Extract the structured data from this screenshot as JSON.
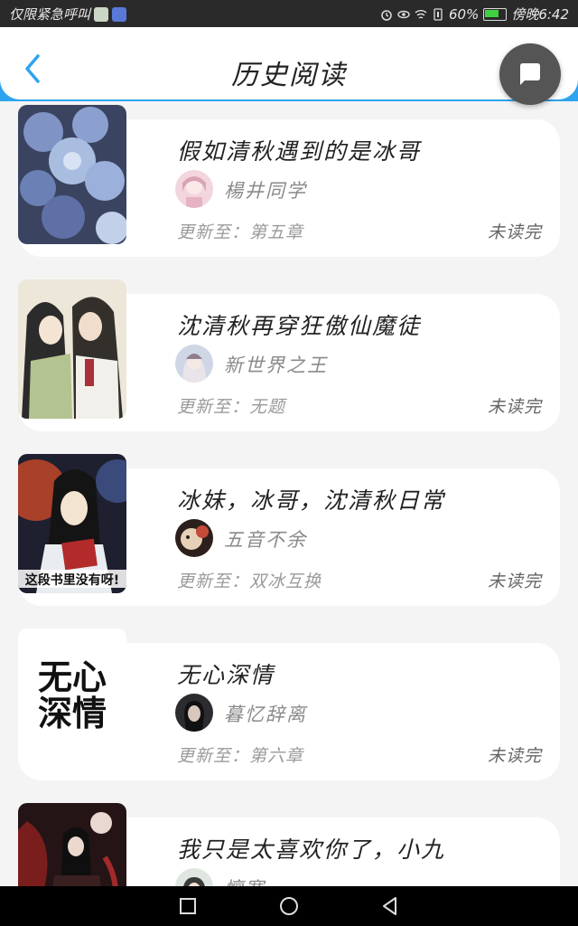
{
  "status_bar": {
    "carrier": "仅限紧急呼叫",
    "battery": "60%",
    "time": "傍晚6:42"
  },
  "header": {
    "title": "历史阅读"
  },
  "books": [
    {
      "title": "假如清秋遇到的是冰哥",
      "author": "楊井同学",
      "update": "更新至：第五章",
      "status": "未读完"
    },
    {
      "title": "沈清秋再穿狂傲仙魔徒",
      "author": "新世界之王",
      "update": "更新至：无题",
      "status": "未读完"
    },
    {
      "title": "冰妹，冰哥，沈清秋日常",
      "author": "五音不余",
      "update": "更新至：双冰互换",
      "status": "未读完",
      "cover_text": "这段书里没有呀!"
    },
    {
      "title": "无心深情",
      "author": "暮忆辞离",
      "update": "更新至：第六章",
      "status": "未读完",
      "cover_text_1": "无心",
      "cover_text_2": "深情"
    },
    {
      "title": "我只是太喜欢你了，小九",
      "author": "懔寒",
      "update": "",
      "status": ""
    }
  ],
  "colors": {
    "accent": "#2ea3ee",
    "background": "#f4f4f4",
    "card": "#ffffff",
    "fab": "#555555"
  }
}
